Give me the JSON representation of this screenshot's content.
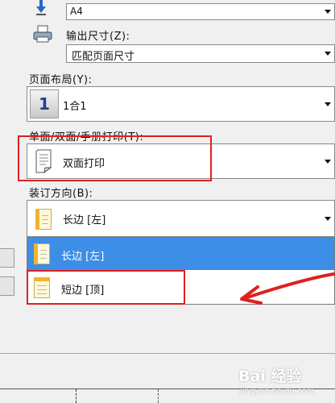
{
  "paper_size": {
    "value": "A4"
  },
  "output_size": {
    "label": "输出尺寸(Z):",
    "value": "匹配页面尺寸"
  },
  "page_layout": {
    "label": "页面布局(Y):",
    "number": "1",
    "value": "1合1"
  },
  "print_mode": {
    "label": "单面/双面/手册打印(T):",
    "value": "双面打印"
  },
  "binding": {
    "label": "装订方向(B):",
    "value": "长边 [左]",
    "options": [
      {
        "label": "长边 [左]",
        "selected": true
      },
      {
        "label": "短边 [顶]",
        "selected": false
      }
    ]
  },
  "watermark": {
    "text": "Bai 经验",
    "sub": "jingyan.baidu.com"
  },
  "colors": {
    "highlight": "#3d8ee6",
    "annotation_red": "#e02020"
  }
}
